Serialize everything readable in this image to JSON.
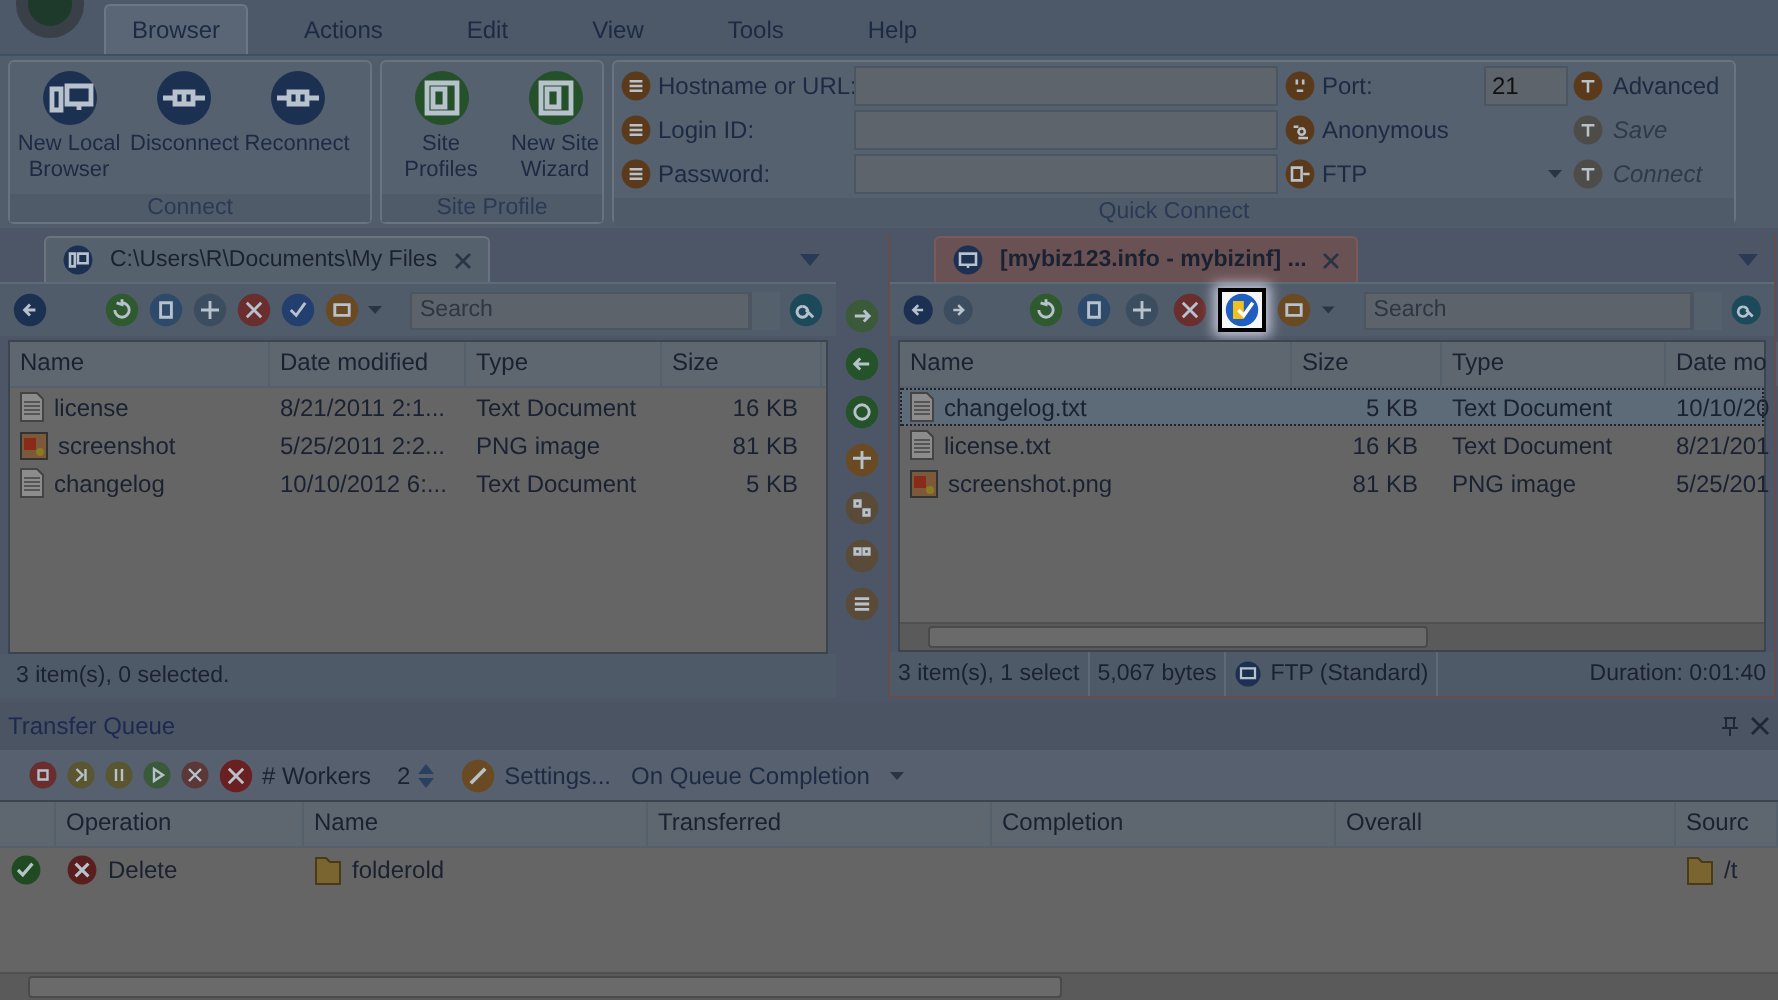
{
  "ribbon": {
    "tabs": [
      {
        "label": "Browser",
        "selected": true
      },
      {
        "label": "Actions",
        "selected": false
      },
      {
        "label": "Edit",
        "selected": false
      },
      {
        "label": "View",
        "selected": false
      },
      {
        "label": "Tools",
        "selected": false
      },
      {
        "label": "Help",
        "selected": false
      }
    ],
    "connect_group": {
      "label": "Connect",
      "buttons": [
        {
          "label": "New Local Browser"
        },
        {
          "label": "Disconnect"
        },
        {
          "label": "Reconnect"
        }
      ]
    },
    "site_profile_group": {
      "label": "Site Profile",
      "buttons": [
        {
          "label": "Site Profiles"
        },
        {
          "label": "New Site Wizard"
        }
      ]
    },
    "quick_connect": {
      "label": "Quick Connect",
      "fields": [
        {
          "label": "Hostname or URL:"
        },
        {
          "label": "Login ID:"
        },
        {
          "label": "Password:"
        }
      ],
      "port_label": "Port:",
      "port_value": "21",
      "anonymous": "Anonymous",
      "protocol": "FTP",
      "actions": [
        {
          "label": "Advanced",
          "disabled": false
        },
        {
          "label": "Save",
          "disabled": true
        },
        {
          "label": "Connect",
          "disabled": true
        }
      ]
    }
  },
  "local_pane": {
    "tab_title": "C:\\Users\\R\\Documents\\My Files",
    "search_placeholder": "Search",
    "columns": [
      "Name",
      "Date modified",
      "Type",
      "Size"
    ],
    "rows": [
      {
        "kind": "text",
        "selected": false,
        "cells": [
          "license",
          "8/21/2011 2:1...",
          "Text Document",
          "16 KB"
        ]
      },
      {
        "kind": "image",
        "selected": false,
        "cells": [
          "screenshot",
          "5/25/2011 2:2...",
          "PNG image",
          "81 KB"
        ]
      },
      {
        "kind": "text",
        "selected": false,
        "cells": [
          "changelog",
          "10/10/2012 6:...",
          "Text Document",
          "5 KB"
        ]
      }
    ],
    "status": "3 item(s), 0 selected."
  },
  "remote_pane": {
    "tab_title": "[mybiz123.info - mybizinf] ...",
    "toolbar_buttons": [
      {
        "highlighted": false
      },
      {
        "highlighted": false
      },
      {
        "highlighted": false
      },
      {
        "highlighted": false
      },
      {
        "highlighted": true
      },
      {
        "highlighted": false
      }
    ],
    "search_placeholder": "Search",
    "columns": [
      "Name",
      "Size",
      "Type",
      "Date mo"
    ],
    "rows": [
      {
        "kind": "text",
        "selected": true,
        "cells": [
          "changelog.txt",
          "5 KB",
          "Text Document",
          "10/10/20"
        ]
      },
      {
        "kind": "text",
        "selected": false,
        "cells": [
          "license.txt",
          "16 KB",
          "Text Document",
          "8/21/201"
        ]
      },
      {
        "kind": "image",
        "selected": false,
        "cells": [
          "screenshot.png",
          "81 KB",
          "PNG image",
          "5/25/201"
        ]
      }
    ],
    "status": [
      "3 item(s), 1 select",
      "5,067 bytes",
      "FTP (Standard)",
      "Duration: 0:01:40"
    ]
  },
  "transfer_queue": {
    "title": "Transfer Queue",
    "workers_label": "# Workers",
    "workers_value": "2",
    "settings": "Settings...",
    "completion_menu": "On Queue Completion",
    "columns": [
      "Operation",
      "Name",
      "Transferred",
      "Completion",
      "Overall",
      "Sourc"
    ],
    "rows": [
      {
        "done": true,
        "cells": [
          "Delete",
          "folderold",
          "",
          "",
          "",
          "/t"
        ]
      }
    ]
  }
}
